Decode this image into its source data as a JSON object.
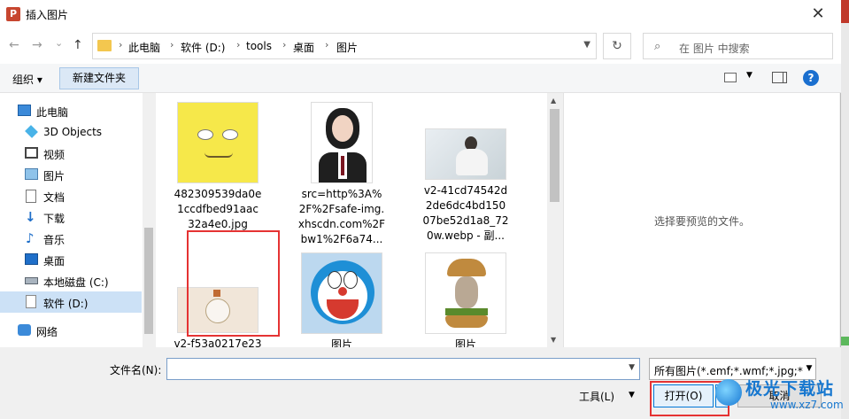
{
  "window": {
    "title": "插入图片",
    "app_icon_letter": "P",
    "close_glyph": "✕"
  },
  "navigation": {
    "back_glyph": "←",
    "forward_glyph": "→",
    "dropdown_glyph": "⌄",
    "up_glyph": "↑",
    "breadcrumbs": [
      "此电脑",
      "软件 (D:)",
      "tools",
      "桌面",
      "图片"
    ],
    "refresh_glyph": "↻",
    "search_placeholder": "在 图片 中搜索",
    "search_glyph": "⌕"
  },
  "toolbar": {
    "organize_label": "组织 ▾",
    "new_folder_label": "新建文件夹",
    "help_glyph": "?"
  },
  "sidebar": {
    "items": [
      {
        "label": "此电脑",
        "icon": "computer-icon"
      },
      {
        "label": "3D Objects",
        "icon": "cube-icon"
      },
      {
        "label": "视频",
        "icon": "video-icon"
      },
      {
        "label": "图片",
        "icon": "picture-icon"
      },
      {
        "label": "文档",
        "icon": "document-icon"
      },
      {
        "label": "下载",
        "icon": "download-icon"
      },
      {
        "label": "音乐",
        "icon": "music-icon"
      },
      {
        "label": "桌面",
        "icon": "desktop-icon"
      },
      {
        "label": "本地磁盘 (C:)",
        "icon": "drive-icon"
      },
      {
        "label": "软件 (D:)",
        "icon": "drive-icon",
        "selected": true
      },
      {
        "label": "网络",
        "icon": "network-icon"
      }
    ]
  },
  "files": [
    {
      "name_lines": [
        "482309539da0e",
        "1ccdfbed91aac",
        "32a4e0.jpg"
      ]
    },
    {
      "name_lines": [
        "src=http%3A%",
        "2F%2Fsafe-img.",
        "xhscdn.com%2F",
        "bw1%2F6a74..."
      ]
    },
    {
      "name_lines": [
        "v2-41cd74542d",
        "2de6dc4bd150",
        "07be52d1a8_72",
        "0w.webp - 副..."
      ]
    },
    {
      "name_lines": [
        "v2-f53a0217e23"
      ]
    },
    {
      "name_lines": [
        "图片"
      ]
    },
    {
      "name_lines": [
        "图片"
      ]
    }
  ],
  "preview": {
    "message": "选择要预览的文件。"
  },
  "footer": {
    "filename_label": "文件名(N):",
    "filename_value": "",
    "filetype_value": "所有图片(*.emf;*.wmf;*.jpg;*.jpeg",
    "tools_label": "工具(L)",
    "open_label": "打开(O)",
    "cancel_label": "取消"
  },
  "watermark": {
    "text": "极光下载站",
    "url": "www.xz7.com"
  },
  "colors": {
    "accent": "#0078d7",
    "highlight": "#e53333",
    "selected": "#cce1f6"
  }
}
